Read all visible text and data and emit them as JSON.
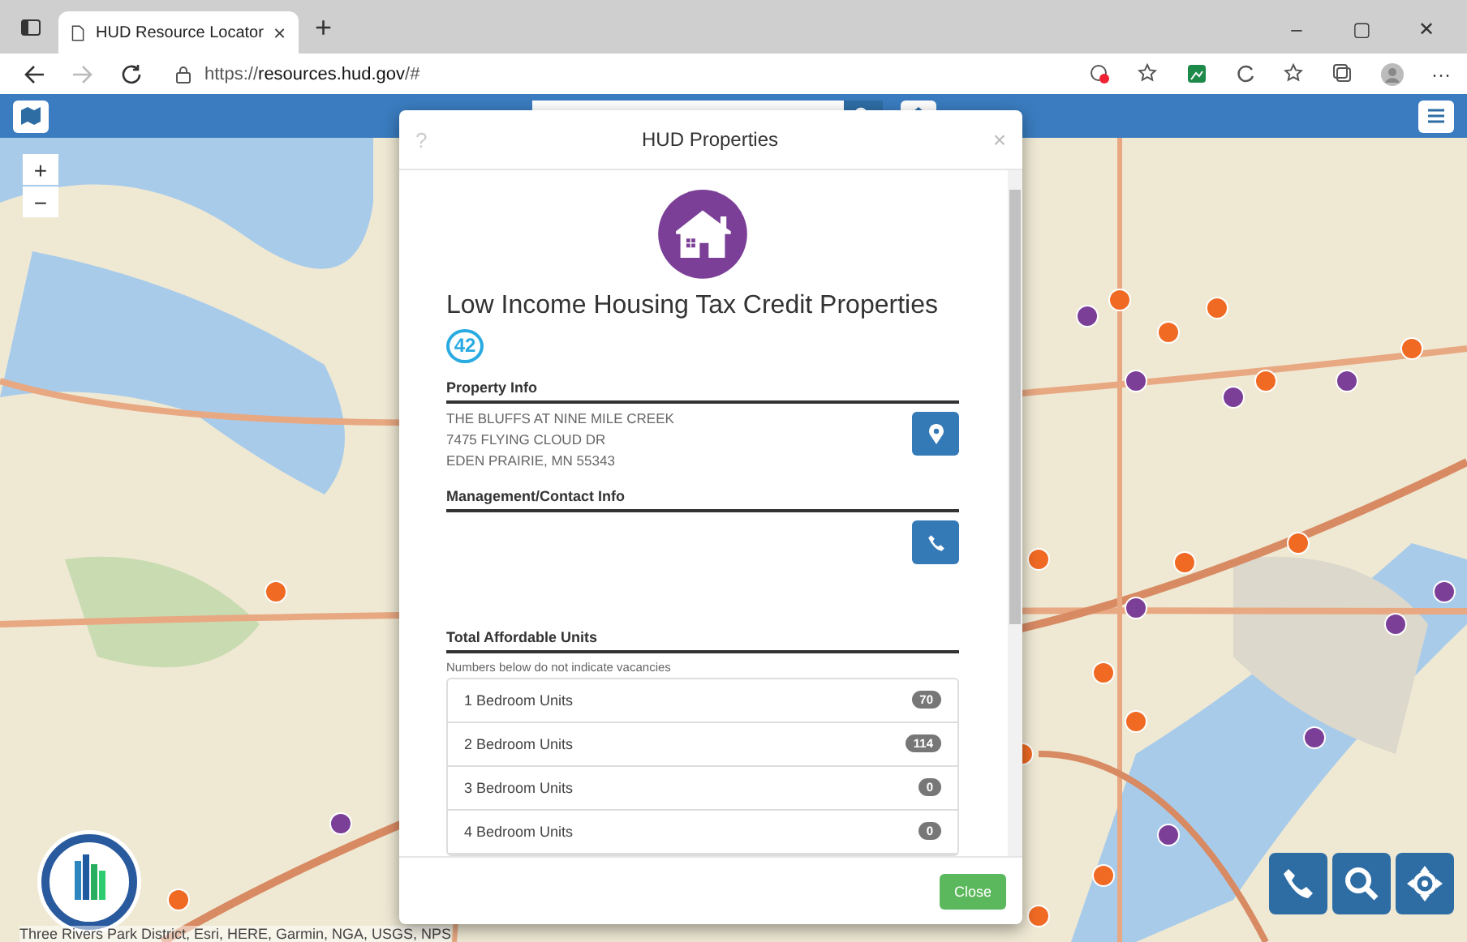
{
  "browser": {
    "tab_title": "HUD Resource Locator",
    "url_scheme": "https://",
    "url_host": "resources.hud.gov",
    "url_path": "/#",
    "new_tab": "+",
    "window_controls": [
      "–",
      "▢",
      "✕"
    ],
    "menu": "···"
  },
  "map": {
    "zoom_controls": [
      "+",
      "−"
    ],
    "attribution": "Three Rivers Park District, Esri, HERE, Garmin, NGA, USGS, NPS"
  },
  "modal": {
    "help": "?",
    "title": "HUD Properties",
    "close_x": "×",
    "heading": "Low Income Housing Tax Credit Properties",
    "count": "42",
    "property_info": {
      "heading": "Property Info",
      "lines": [
        "THE BLUFFS AT NINE MILE CREEK",
        "7475 FLYING CLOUD DR",
        "EDEN PRAIRIE, MN 55343"
      ]
    },
    "management": {
      "heading": "Management/Contact Info"
    },
    "units": {
      "heading": "Total Affordable Units",
      "note": "Numbers below do not indicate vacancies",
      "rows": [
        {
          "label": "1 Bedroom Units",
          "count": "70"
        },
        {
          "label": "2 Bedroom Units",
          "count": "114"
        },
        {
          "label": "3 Bedroom Units",
          "count": "0"
        },
        {
          "label": "4 Bedroom Units",
          "count": "0"
        }
      ]
    },
    "close_button": "Close"
  }
}
